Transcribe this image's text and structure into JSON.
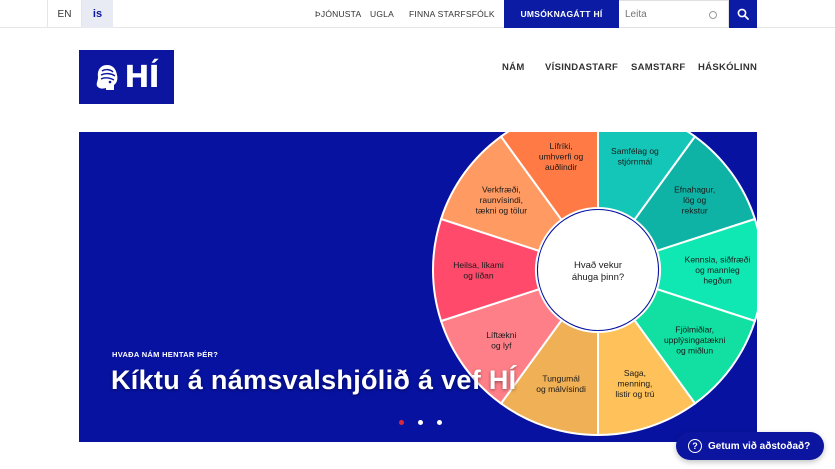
{
  "topbar": {
    "lang_en": "EN",
    "lang_is": "is",
    "links": [
      "ÞJÓNUSTA",
      "UGLA",
      "FINNA STARFSFÓLK"
    ],
    "apply_label": "UMSÓKNAGÁTT HÍ",
    "search_placeholder": "Leita"
  },
  "header": {
    "logo_text": "HÍ",
    "nav": [
      "NÁM",
      "VÍSINDASTARF",
      "SAMSTARF",
      "HÁSKÓLINN"
    ]
  },
  "hero": {
    "eyebrow": "HVAÐA NÁM HENTAR ÞÉR?",
    "headline": "Kíktu á námsvalshjólið á vef HÍ",
    "center_lines": [
      "Hvað vekur",
      "áhuga þinn?"
    ],
    "segments": [
      {
        "lines": [
          "Samfélag og",
          "stjórnmál"
        ],
        "color": "#14c6b8"
      },
      {
        "lines": [
          "Efnahagur,",
          "lög og",
          "rekstur"
        ],
        "color": "#0fb3a5"
      },
      {
        "lines": [
          "Kennsla, siðfræði",
          "og mannleg",
          "hegðun"
        ],
        "color": "#10e8b4"
      },
      {
        "lines": [
          "Fjölmiðlar,",
          "upplýsingatækni",
          "og miðlun"
        ],
        "color": "#12dfa2"
      },
      {
        "lines": [
          "Saga,",
          "menning,",
          "listir og trú"
        ],
        "color": "#ffc25a"
      },
      {
        "lines": [
          "Tungumál",
          "og málvísindi"
        ],
        "color": "#f0b055"
      },
      {
        "lines": [
          "Líftækni",
          "og lyf"
        ],
        "color": "#ff7f88"
      },
      {
        "lines": [
          "Heilsa, líkami",
          "og líðan"
        ],
        "color": "#ff4a6c"
      },
      {
        "lines": [
          "Verkfræði,",
          "raunvísindi,",
          "tækni og tölur"
        ],
        "color": "#ff9a62"
      },
      {
        "lines": [
          "Lífríki,",
          "umhverfi og",
          "auðlindir"
        ],
        "color": "#ff7a45"
      }
    ],
    "slide_count": 3,
    "active_slide": 1
  },
  "help": {
    "label": "Getum við aðstoðað?"
  }
}
